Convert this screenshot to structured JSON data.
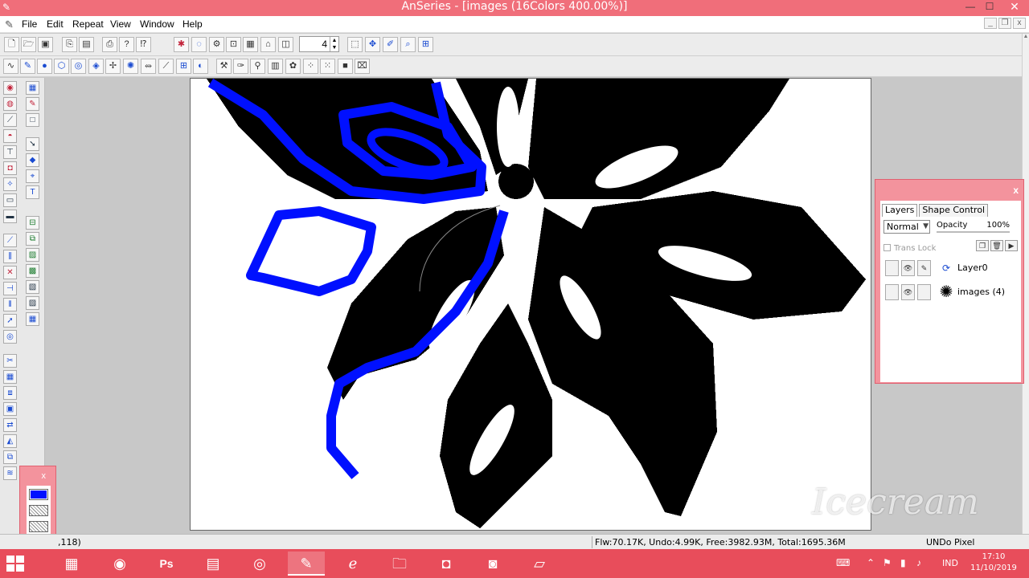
{
  "window": {
    "title": "AnSeries - [images (16Colors 400.00%)]",
    "minimize": "—",
    "maximize": "☐",
    "close": "✕"
  },
  "menu": {
    "items": [
      "File",
      "Edit",
      "Repeat",
      "View",
      "Window",
      "Help"
    ]
  },
  "toolbar": {
    "spin_value": "4"
  },
  "palette": {
    "close": "x"
  },
  "layers_panel": {
    "close": "x",
    "tabs": [
      "Layers",
      "Shape Control"
    ],
    "blend_mode": "Normal",
    "opacity_label": "Opacity",
    "opacity_value": "100%",
    "trans_lock": "Trans Lock",
    "layers": [
      {
        "name": "Layer0"
      },
      {
        "name": "images (4)"
      }
    ]
  },
  "status": {
    "coordinates": ",118)",
    "memory": "Flw:70.17K, Undo:4.99K, Free:3982.93M, Total:1695.36M",
    "mode": "UNDo Pixel"
  },
  "taskbar": {
    "lang": "IND",
    "time": "17:10",
    "date": "11/10/2019"
  },
  "watermark": "Icecream",
  "colors": {
    "title_bar": "#f06e7a",
    "taskbar": "#e84d5b",
    "selection_blue": "#0010ff"
  }
}
